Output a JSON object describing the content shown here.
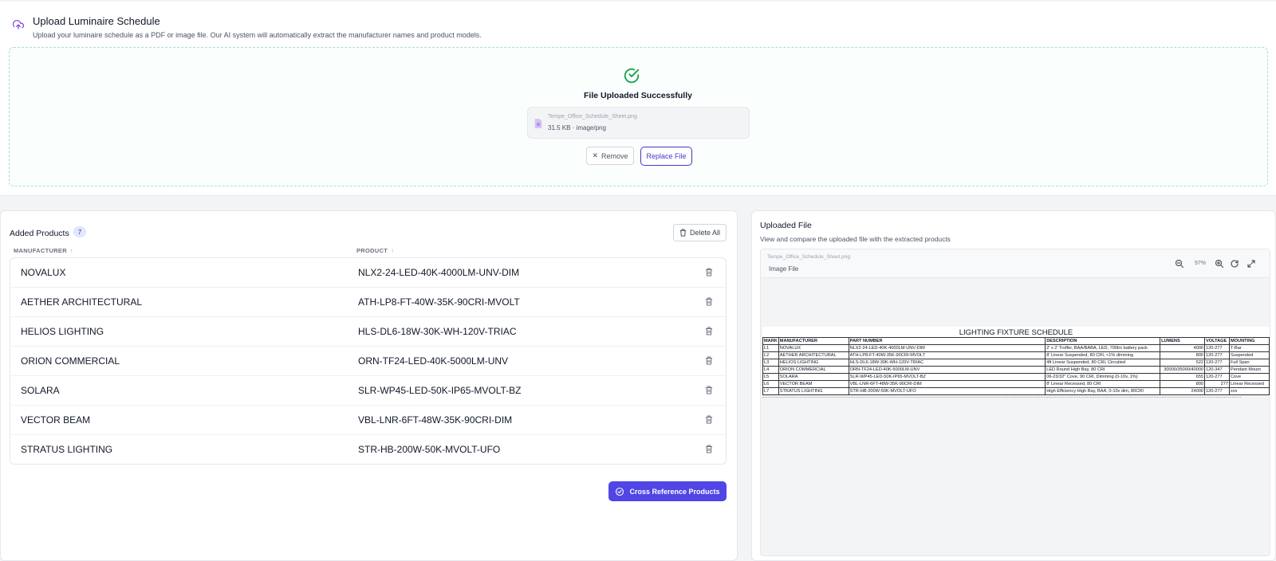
{
  "upload": {
    "title": "Upload Luminaire Schedule",
    "subtitle": "Upload your luminaire schedule as a PDF or image file. Our AI system will automatically extract the manufacturer names and product models.",
    "success": "File Uploaded Successfully",
    "file_name": "Tempe_Office_Schedule_Sheet.png",
    "file_meta": "31.5 KB · image/png",
    "remove_label": "Remove",
    "replace_label": "Replace File"
  },
  "products": {
    "title": "Added Products",
    "count": "7",
    "delete_all_label": "Delete All",
    "columns": {
      "manufacturer": "MANUFACTURER",
      "product": "PRODUCT"
    },
    "rows": [
      {
        "manufacturer": "NOVALUX",
        "product": "NLX2-24-LED-40K-4000LM-UNV-DIM"
      },
      {
        "manufacturer": "AETHER ARCHITECTURAL",
        "product": "ATH-LP8-FT-40W-35K-90CRI-MVOLT"
      },
      {
        "manufacturer": "HELIOS LIGHTING",
        "product": "HLS-DL6-18W-30K-WH-120V-TRIAC"
      },
      {
        "manufacturer": "ORION COMMERCIAL",
        "product": "ORN-TF24-LED-40K-5000LM-UNV"
      },
      {
        "manufacturer": "SOLARA",
        "product": "SLR-WP45-LED-50K-IP65-MVOLT-BZ"
      },
      {
        "manufacturer": "VECTOR BEAM",
        "product": "VBL-LNR-6FT-48W-35K-90CRI-DIM"
      },
      {
        "manufacturer": "STRATUS LIGHTING",
        "product": "STR-HB-200W-50K-MVOLT-UFO"
      }
    ],
    "cross_reference_label": "Cross Reference Products"
  },
  "uploaded_file": {
    "title": "Uploaded File",
    "subtitle": "View and compare the uploaded file with the extracted products",
    "viewer_file_name": "Tempe_Office_Schedule_Sheet.png",
    "viewer_file_type": "Image File",
    "zoom": "97%",
    "sheet": {
      "title": "LIGHTING FIXTURE SCHEDULE",
      "headers": [
        "MARK",
        "MANUFACTURER",
        "PART NUMBER",
        "DESCRIPTION",
        "LUMENS",
        "VOLTAGE",
        "MOUNTING"
      ],
      "rows": [
        [
          "L1",
          "NOVALUX",
          "NLX2-24-LED-40K-4000LM-UNV-DIM",
          "2' x 2' Troffer, BAA/BABA, LED, 700lm battery pack",
          "4000",
          "120-277",
          "T-Bar"
        ],
        [
          "L2",
          "AETHER ARCHITECTURAL",
          "ATH-LP8-FT-40W-35K-90CRI-MVOLT",
          "8' Linear Suspended, 80 CRI, <1% dimming",
          "800",
          "120-277",
          "Suspended"
        ],
        [
          "L3",
          "HELIOS LIGHTING",
          "HLS-DL6-18W-30K-WH-120V-TRIAC",
          "4ft Linear Suspended, 80 CRI, Circuited",
          "522",
          "120-277",
          "Full Span"
        ],
        [
          "L4",
          "ORION COMMERCIAL",
          "ORN-TF24-LED-40K-5000LM-UNV",
          "LED Round High Bay, 80 CRI",
          "30000/35000/40000",
          "120-347",
          "Pendant Mount"
        ],
        [
          "L5",
          "SOLARA",
          "SLR-WP45-LED-50K-IP65-MVOLT-BZ",
          "06-23/32\" Cove, 90 CRI, Dimming (0-10v, 1%)",
          "655",
          "120-277",
          "Cove"
        ],
        [
          "L6",
          "VECTOR BEAM",
          "VBL-LNR-6FT-48W-35K-90CRI-DIM",
          "8' Linear Recessed, 80 CRI",
          "800",
          "277",
          "Linear Recessed"
        ],
        [
          "L7",
          "STRATUS LIGHTING",
          "STR-HB-200W-50K-MVOLT-UFO",
          "High Efficiency High Bay, BAA, 0-10v dim, 80CRI",
          "24000",
          "120-277",
          "xxx"
        ]
      ]
    }
  },
  "colors": {
    "accent": "#4f46e5",
    "success": "#16a34a",
    "icon_purple": "#7c3aed"
  }
}
